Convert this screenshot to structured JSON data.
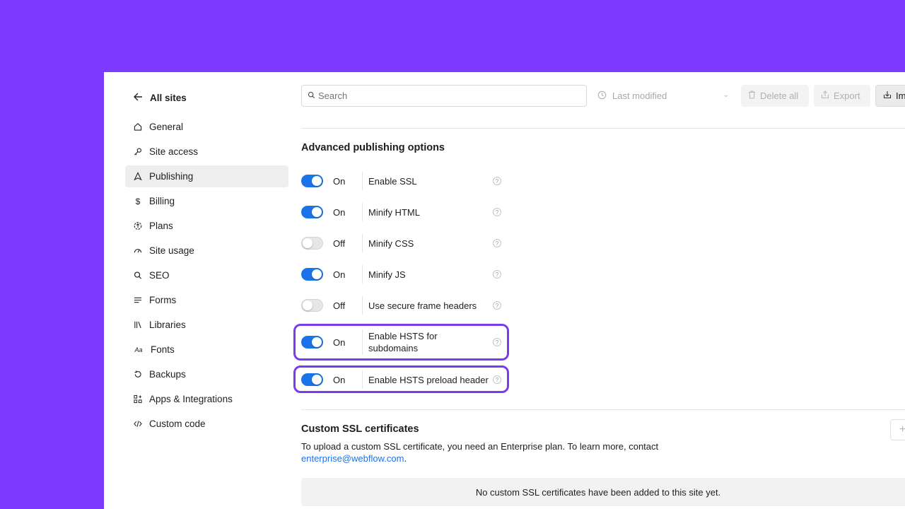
{
  "sidebar": {
    "back_label": "All sites",
    "items": [
      {
        "label": "General",
        "icon": "home-icon"
      },
      {
        "label": "Site access",
        "icon": "key-icon"
      },
      {
        "label": "Publishing",
        "icon": "rocket-icon",
        "active": true
      },
      {
        "label": "Billing",
        "icon": "dollar-icon"
      },
      {
        "label": "Plans",
        "icon": "plans-icon"
      },
      {
        "label": "Site usage",
        "icon": "gauge-icon"
      },
      {
        "label": "SEO",
        "icon": "search-icon"
      },
      {
        "label": "Forms",
        "icon": "forms-icon"
      },
      {
        "label": "Libraries",
        "icon": "libraries-icon"
      },
      {
        "label": "Fonts",
        "icon": "fonts-icon"
      },
      {
        "label": "Backups",
        "icon": "backup-icon"
      },
      {
        "label": "Apps & Integrations",
        "icon": "apps-icon"
      },
      {
        "label": "Custom code",
        "icon": "code-icon"
      }
    ]
  },
  "toolbar": {
    "search_placeholder": "Search",
    "sort_label": "Last modified",
    "delete_label": "Delete all",
    "export_label": "Export",
    "import_label": "Im"
  },
  "publishing": {
    "title": "Advanced publishing options",
    "options": [
      {
        "label": "Enable SSL",
        "state": "On",
        "on": true
      },
      {
        "label": "Minify HTML",
        "state": "On",
        "on": true
      },
      {
        "label": "Minify CSS",
        "state": "Off",
        "on": false
      },
      {
        "label": "Minify JS",
        "state": "On",
        "on": true
      },
      {
        "label": "Use secure frame headers",
        "state": "Off",
        "on": false
      },
      {
        "label": "Enable HSTS for subdomains",
        "state": "On",
        "on": true
      },
      {
        "label": "Enable HSTS preload header",
        "state": "On",
        "on": true
      }
    ]
  },
  "ssl": {
    "title": "Custom SSL certificates",
    "text_before": "To upload a custom SSL certificate, you need an Enterprise plan. To learn more, contact",
    "link": "enterprise@webflow.com",
    "text_after": ".",
    "empty": "No custom SSL certificates have been added to this site yet."
  },
  "colors": {
    "background": "#7c3aff",
    "toggle_on": "#1a73e8",
    "highlight": "#7c3aed",
    "link": "#1a73e8"
  }
}
